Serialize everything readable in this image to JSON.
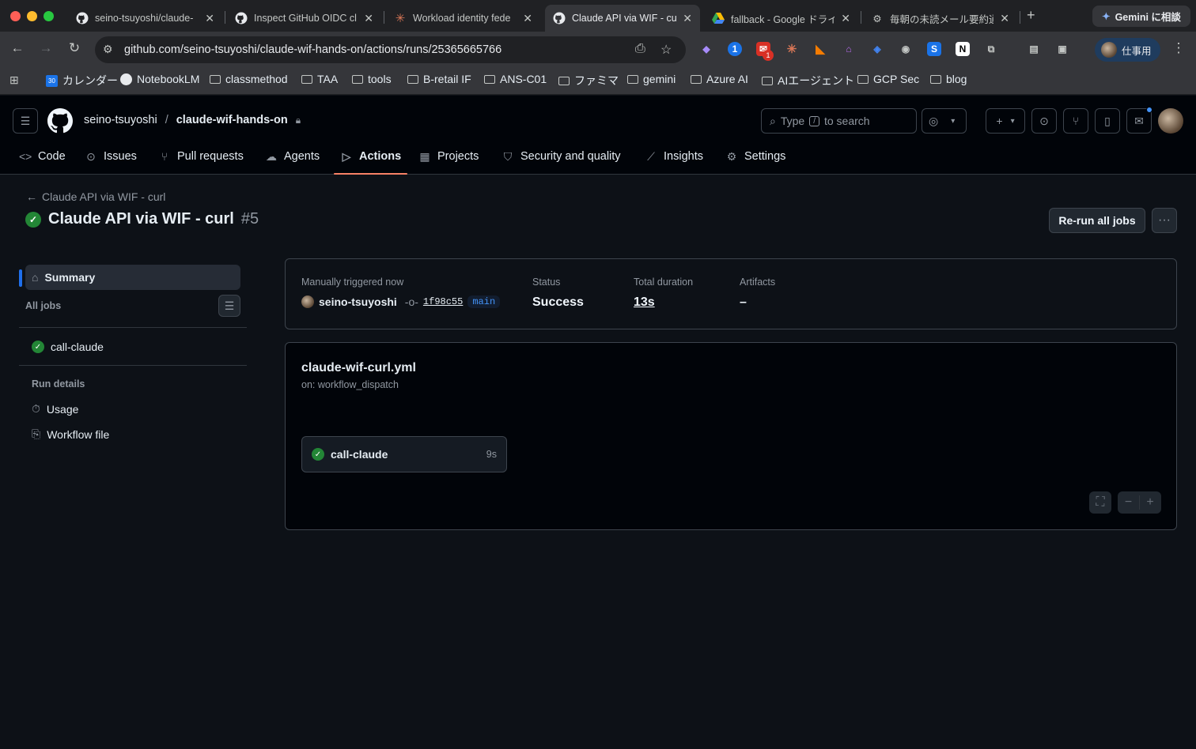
{
  "browser": {
    "tabs": [
      {
        "title": "seino-tsuyoshi/claude-",
        "favicon": "github-icon"
      },
      {
        "title": "Inspect GitHub OIDC cl",
        "favicon": "github-icon"
      },
      {
        "title": "Workload identity fede",
        "favicon": "claude-icon"
      },
      {
        "title": "Claude API via WIF - cu",
        "favicon": "github-icon"
      },
      {
        "title": "fallback - Google ドライ",
        "favicon": "drive-icon"
      },
      {
        "title": "毎朝の未読メール要約通知",
        "favicon": "zapier-icon"
      }
    ],
    "gemini_label": "Gemini に相談",
    "url": "github.com/seino-tsuyoshi/claude-wif-hands-on/actions/runs/25365665766",
    "gmail_badge": "1",
    "profile_label": "仕事用",
    "bookmarks": [
      "カレンダー",
      "NotebookLM",
      "classmethod",
      "TAA",
      "tools",
      "B-retail IF",
      "ANS-C01",
      "ファミマ",
      "gemini",
      "Azure AI",
      "AIエージェント",
      "GCP Sec",
      "blog"
    ],
    "calendar_day": "30"
  },
  "repo": {
    "owner": "seino-tsuyoshi",
    "name": "claude-wif-hands-on"
  },
  "search": {
    "prefix": "Type",
    "key": "/",
    "suffix": "to search"
  },
  "nav": [
    {
      "label": "Code",
      "icon": "code-icon"
    },
    {
      "label": "Issues",
      "icon": "issue-icon"
    },
    {
      "label": "Pull requests",
      "icon": "pull-request-icon"
    },
    {
      "label": "Agents",
      "icon": "agents-icon"
    },
    {
      "label": "Actions",
      "icon": "play-icon",
      "active": true
    },
    {
      "label": "Projects",
      "icon": "table-icon"
    },
    {
      "label": "Security and quality",
      "icon": "shield-icon"
    },
    {
      "label": "Insights",
      "icon": "graph-icon"
    },
    {
      "label": "Settings",
      "icon": "gear-icon"
    }
  ],
  "run": {
    "back_label": "Claude API via WIF - curl",
    "title": "Claude API via WIF - curl",
    "number": "#5",
    "rerun_label": "Re-run all jobs"
  },
  "sidebar": {
    "summary": "Summary",
    "all_jobs": "All jobs",
    "jobs": [
      {
        "name": "call-claude",
        "status": "success"
      }
    ],
    "run_details": "Run details",
    "details": [
      {
        "label": "Usage",
        "icon": "stopwatch-icon"
      },
      {
        "label": "Workflow file",
        "icon": "file-icon"
      }
    ]
  },
  "summary": {
    "trigger_label": "Manually triggered now",
    "actor": "seino-tsuyoshi",
    "commit": "1f98c55",
    "branch": "main",
    "status_label": "Status",
    "status_value": "Success",
    "duration_label": "Total duration",
    "duration_value": "13s",
    "artifacts_label": "Artifacts",
    "artifacts_value": "–"
  },
  "workflow": {
    "file": "claude-wif-curl.yml",
    "trigger": "on: workflow_dispatch",
    "job": {
      "name": "call-claude",
      "duration": "9s"
    }
  },
  "colors": {
    "success": "#238636",
    "accent": "#1f6feb",
    "tab_underline": "#f78166"
  }
}
